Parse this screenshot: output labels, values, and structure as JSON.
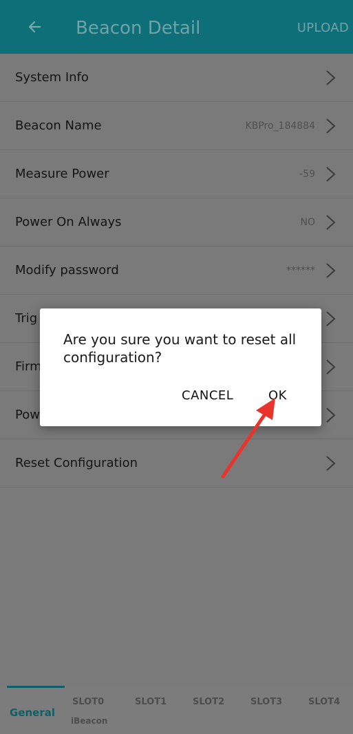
{
  "header": {
    "back_icon": "back-arrow-icon",
    "title": "Beacon Detail",
    "upload_label": "UPLOAD"
  },
  "list": {
    "items": [
      {
        "label": "System Info",
        "value": ""
      },
      {
        "label": "Beacon Name",
        "value": "KBPro_184884"
      },
      {
        "label": "Measure Power",
        "value": "-59"
      },
      {
        "label": "Power On Always",
        "value": "NO"
      },
      {
        "label": "Modify password",
        "value": "******"
      },
      {
        "label": "Trig",
        "value": ""
      },
      {
        "label": "Firm",
        "value": ""
      },
      {
        "label": "Pow",
        "value": ""
      },
      {
        "label": "Reset Configuration",
        "value": ""
      }
    ]
  },
  "dialog": {
    "message": "Are you sure you want to reset all configuration?",
    "cancel_label": "CANCEL",
    "ok_label": "OK"
  },
  "tabs": {
    "general": "General",
    "slot0": "SLOT0",
    "slot0_sub": "iBeacon",
    "slot1": "SLOT1",
    "slot2": "SLOT2",
    "slot3": "SLOT3",
    "slot4": "SLOT4"
  },
  "colors": {
    "appbar": "#0f6f78",
    "annotation_arrow": "#e8342b"
  }
}
